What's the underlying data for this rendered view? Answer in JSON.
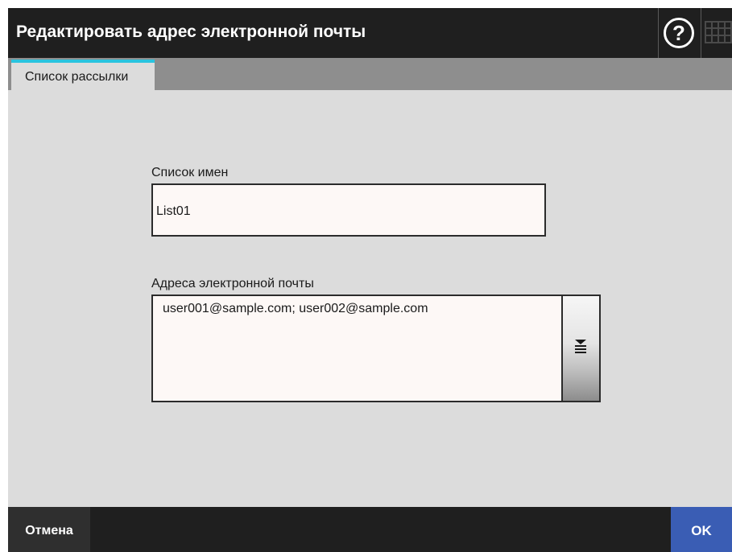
{
  "window": {
    "title": "Редактировать адрес электронной почты",
    "help_label": "?",
    "help_icon": "help-icon",
    "keyboard_icon": "keyboard-icon"
  },
  "tabs": [
    {
      "label": "Список рассылки",
      "selected": true
    }
  ],
  "form": {
    "name_label": "Список имен",
    "name_value": "List01",
    "emails_label": "Адреса электронной почты",
    "emails_value": "user001@sample.com; user002@sample.com",
    "expand_icon": "expand-list-icon"
  },
  "footer": {
    "cancel_label": "Отмена",
    "ok_label": "OK"
  },
  "colors": {
    "title_bar": "#1f1f1f",
    "background": "#dcdcdc",
    "tab_accent": "#29c4df",
    "ok_button": "#3a5db4",
    "input_background": "#fdf8f6"
  }
}
